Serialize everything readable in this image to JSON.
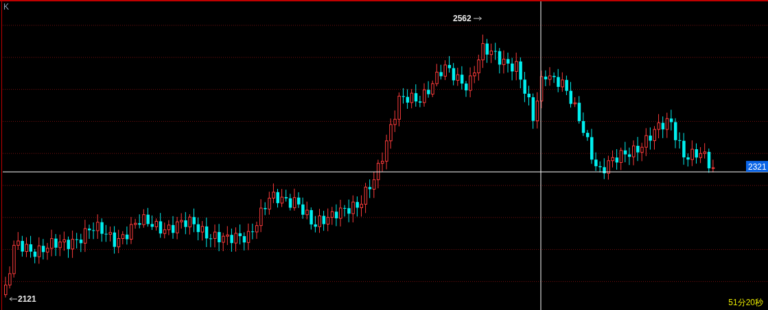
{
  "chart": {
    "label": "K"
  },
  "high_marker": {
    "value": "2562"
  },
  "low_marker": {
    "value": "2121"
  },
  "price_tag": {
    "value": "2321"
  },
  "countdown": "51分20秒"
}
